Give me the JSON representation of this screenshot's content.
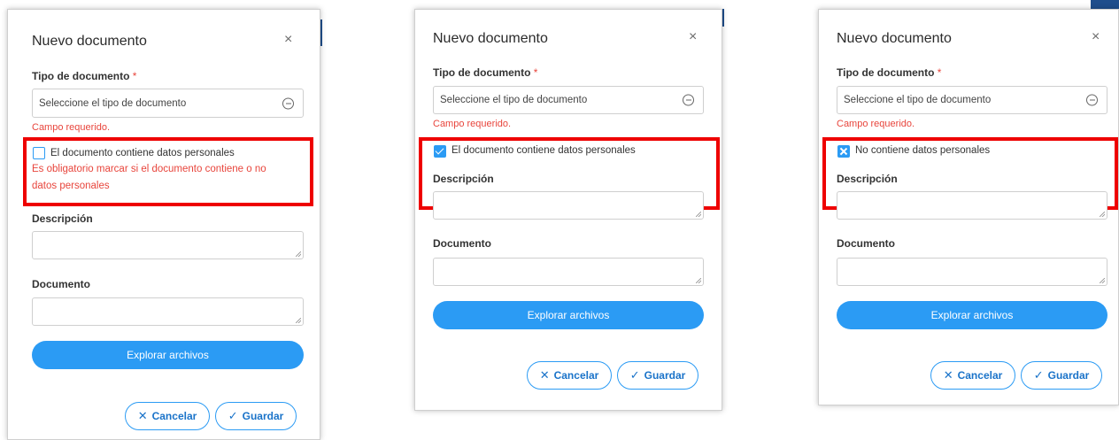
{
  "dialogs": [
    {
      "title": "Nuevo documento",
      "close_glyph": "×",
      "tipo_label": "Tipo de documento",
      "required_mark": "*",
      "select_placeholder": "Seleccione el tipo de documento",
      "campo_error": "Campo requerido.",
      "checkbox_label": "El documento contiene datos personales",
      "checkbox_state": "unchecked",
      "checkbox_error_line1": "Es obligatorio marcar si el documento contiene o no",
      "checkbox_error_line2": "datos personales",
      "descripcion_label": "Descripción",
      "documento_label": "Documento",
      "browse_label": "Explorar archivos",
      "cancel_label": "Cancelar",
      "save_label": "Guardar"
    },
    {
      "title": "Nuevo documento",
      "close_glyph": "×",
      "tipo_label": "Tipo de documento",
      "required_mark": "*",
      "select_placeholder": "Seleccione el tipo de documento",
      "campo_error": "Campo requerido.",
      "checkbox_label": "El documento contiene datos personales",
      "checkbox_state": "checked",
      "descripcion_label": "Descripción",
      "documento_label": "Documento",
      "browse_label": "Explorar archivos",
      "cancel_label": "Cancelar",
      "save_label": "Guardar"
    },
    {
      "title": "Nuevo documento",
      "close_glyph": "×",
      "tipo_label": "Tipo de documento",
      "required_mark": "*",
      "select_placeholder": "Seleccione el tipo de documento",
      "campo_error": "Campo requerido.",
      "checkbox_label": "No contiene datos personales",
      "checkbox_state": "crossed",
      "descripcion_label": "Descripción",
      "documento_label": "Documento",
      "browse_label": "Explorar archivos",
      "cancel_label": "Cancelar",
      "save_label": "Guardar"
    }
  ],
  "icons": {
    "cancel": "x-icon",
    "save": "check-icon",
    "select": "minus-circle-icon"
  },
  "colors": {
    "accent": "#2b9bf4",
    "error": "#e8453c",
    "highlight": "#ee0000"
  }
}
